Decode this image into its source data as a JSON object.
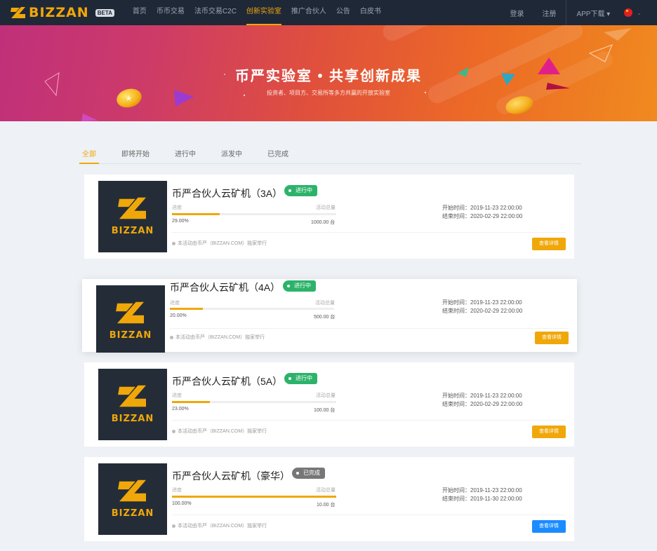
{
  "nav": {
    "brand": "BIZZAN",
    "beta": "BETA",
    "items": [
      "首页",
      "币币交易",
      "法币交易C2C",
      "创新实验室",
      "推广合伙人",
      "公告",
      "白皮书"
    ],
    "active_index": 3,
    "login": "登录",
    "register": "注册",
    "app_download": "APP下载"
  },
  "banner": {
    "title": "币严实验室 • 共享创新成果",
    "subtitle": "投资者、项目方、交易所等多方共赢的开放实验室"
  },
  "tabs": [
    "全部",
    "即将开始",
    "进行中",
    "派发中",
    "已完成"
  ],
  "labels": {
    "progress": "进度",
    "total": "活动总量",
    "start_prefix": "开始时间：",
    "end_prefix": "结束时间：",
    "note": "本活动由币严（BIZZAN.COM）独家举行",
    "detail_button": "查看详情",
    "thumb_text": "BIZZAN"
  },
  "cards": [
    {
      "title": "币严合伙人云矿机（3A）",
      "status": "进行中",
      "progress_text": "29.00%",
      "progress": 0.29,
      "total": "1000.00 台",
      "start": "2019-11-23 22:00:00",
      "end": "2020-02-29 22:00:00"
    },
    {
      "title": "币严合伙人云矿机（4A）",
      "status": "进行中",
      "progress_text": "20.00%",
      "progress": 0.2,
      "total": "500.00 台",
      "start": "2019-11-23 22:00:00",
      "end": "2020-02-29 22:00:00"
    },
    {
      "title": "币严合伙人云矿机（5A）",
      "status": "进行中",
      "progress_text": "23.00%",
      "progress": 0.23,
      "total": "100.00 台",
      "start": "2019-11-23 22:00:00",
      "end": "2020-02-29 22:00:00"
    },
    {
      "title": "币严合伙人云矿机（豪华）",
      "status": "已完成",
      "progress_text": "100.00%",
      "progress": 1.0,
      "total": "10.00 台",
      "start": "2019-11-23 22:00:00",
      "end": "2019-11-30 22:00:00"
    }
  ],
  "colors": {
    "nav_bg": "#1f2837",
    "accent": "#f0a70a",
    "green": "#2cb36a",
    "blue": "#1a8cff"
  }
}
